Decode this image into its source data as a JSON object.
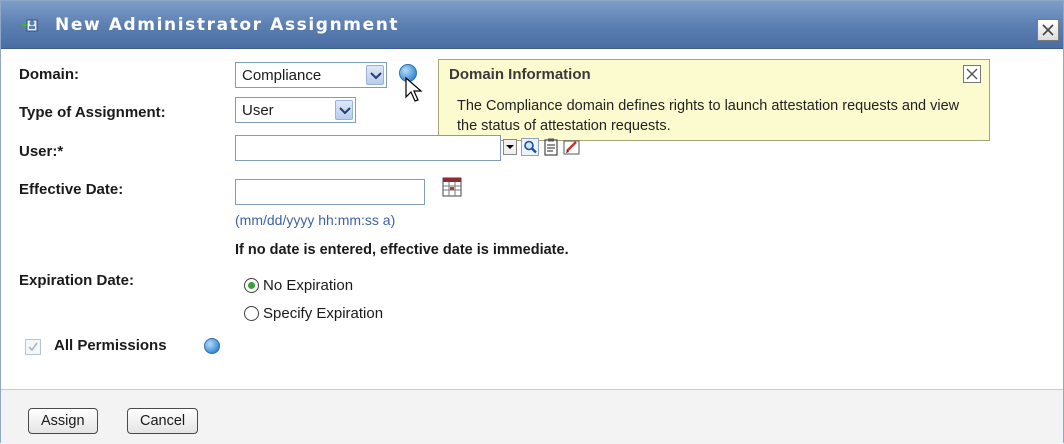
{
  "dialog": {
    "title": "New Administrator Assignment",
    "title_icon": "admin-assignment-icon"
  },
  "form": {
    "domain_label": "Domain:",
    "domain_value": "Compliance",
    "assignment_type_label": "Type of Assignment:",
    "assignment_type_value": "User",
    "user_label": "User:*",
    "user_value": "",
    "effective_date_label": "Effective Date:",
    "effective_date_value": "",
    "date_format_hint": "(mm/dd/yyyy hh:mm:ss a)",
    "effective_date_note": "If no date is entered, effective date is immediate.",
    "expiration_date_label": "Expiration Date:",
    "expiration_options": [
      "No Expiration",
      "Specify Expiration"
    ],
    "expiration_selected": "No Expiration",
    "all_permissions_label": "All Permissions",
    "all_permissions_checked": true
  },
  "tooltip": {
    "title": "Domain Information",
    "body": "The Compliance domain defines rights to launch attestation requests and view the status of attestation requests."
  },
  "footer": {
    "assign_label": "Assign",
    "cancel_label": "Cancel"
  },
  "colors": {
    "titlebar": "#5d80b2",
    "tooltip_bg": "#fcfbcf",
    "hint_text": "#3c62a8",
    "radio_selected": "#39a139"
  }
}
